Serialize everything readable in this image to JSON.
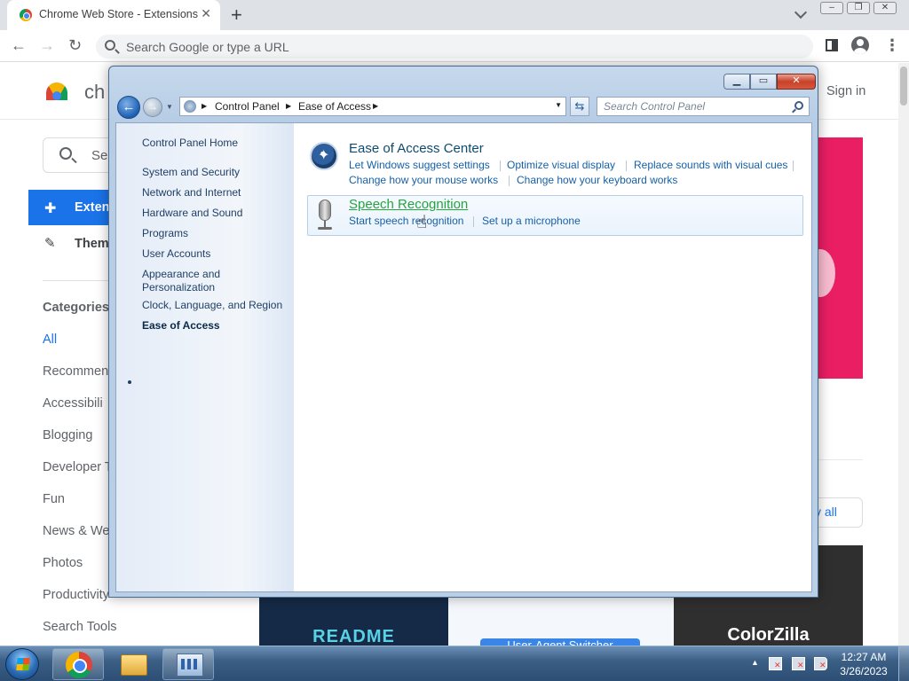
{
  "chrome": {
    "tab_title": "Chrome Web Store - Extensions",
    "omnibox_placeholder": "Search Google or type a URL"
  },
  "webstore": {
    "title": "ch",
    "signin": "Sign in",
    "search_placeholder": "Sea",
    "nav_extensions": "Exten",
    "nav_themes": "Them",
    "categories_heading": "Categories",
    "categories": [
      "All",
      "Recommen",
      "Accessibili",
      "Blogging",
      "Developer T",
      "Fun",
      "News & We",
      "Photos",
      "Productivity",
      "Search Tools"
    ],
    "view_all": "v all",
    "tiles": {
      "readme": "README",
      "uas": "User-Agent Switcher",
      "colorzilla": "ColorZilla"
    }
  },
  "control_panel": {
    "breadcrumb": [
      "Control Panel",
      "Ease of Access"
    ],
    "search_placeholder": "Search Control Panel",
    "left_nav": [
      "Control Panel Home",
      "System and Security",
      "Network and Internet",
      "Hardware and Sound",
      "Programs",
      "User Accounts",
      "Appearance and",
      "Personalization",
      "Clock, Language, and Region",
      "Ease of Access"
    ],
    "eac": {
      "title": "Ease of Access Center",
      "links": [
        "Let Windows suggest settings",
        "Optimize visual display",
        "Replace sounds with visual cues",
        "Change how your mouse works",
        "Change how your keyboard works"
      ]
    },
    "speech": {
      "title": "Speech Recognition",
      "links": [
        "Start speech recognition",
        "Set up a microphone"
      ]
    }
  },
  "taskbar": {
    "time": "12:27 AM",
    "date": "3/26/2023"
  },
  "icons": [
    "chrome-favicon",
    "search-icon",
    "back-icon",
    "forward-icon",
    "reload-icon",
    "side-panel-icon",
    "profile-icon",
    "menu-icon",
    "puzzle-icon",
    "brush-icon",
    "ease-of-access-icon",
    "microphone-icon",
    "hand-cursor-icon",
    "start-orb-icon",
    "explorer-icon",
    "control-panel-icon"
  ]
}
